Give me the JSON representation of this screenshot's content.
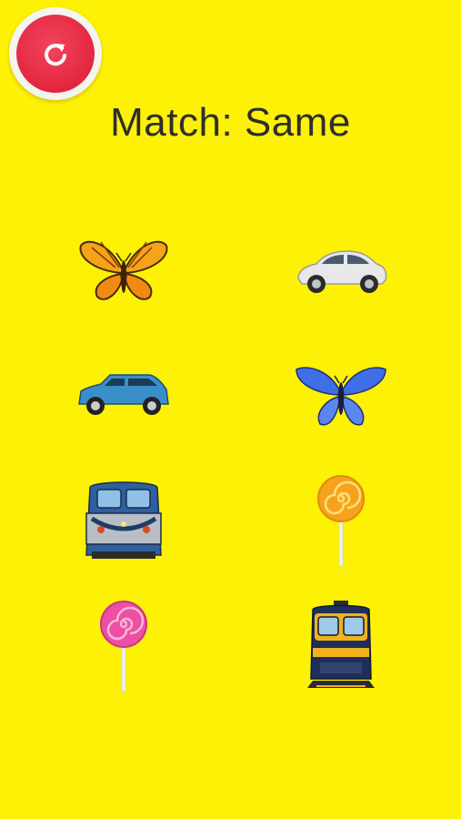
{
  "game": {
    "title": "Match: Same",
    "restart_icon": "restart-icon"
  },
  "tiles": [
    {
      "item": "butterfly",
      "variant": "orange",
      "column": "left"
    },
    {
      "item": "car",
      "variant": "white",
      "column": "right"
    },
    {
      "item": "car",
      "variant": "blue",
      "column": "left"
    },
    {
      "item": "butterfly",
      "variant": "blue",
      "column": "right"
    },
    {
      "item": "train",
      "variant": "gray-blue",
      "column": "left"
    },
    {
      "item": "lollipop",
      "variant": "orange",
      "column": "right"
    },
    {
      "item": "lollipop",
      "variant": "pink",
      "column": "left"
    },
    {
      "item": "train",
      "variant": "yellow-navy",
      "column": "right"
    }
  ],
  "colors": {
    "background": "#fdf106",
    "title_text": "#2e2e2e",
    "restart_button": "#e3263f"
  }
}
